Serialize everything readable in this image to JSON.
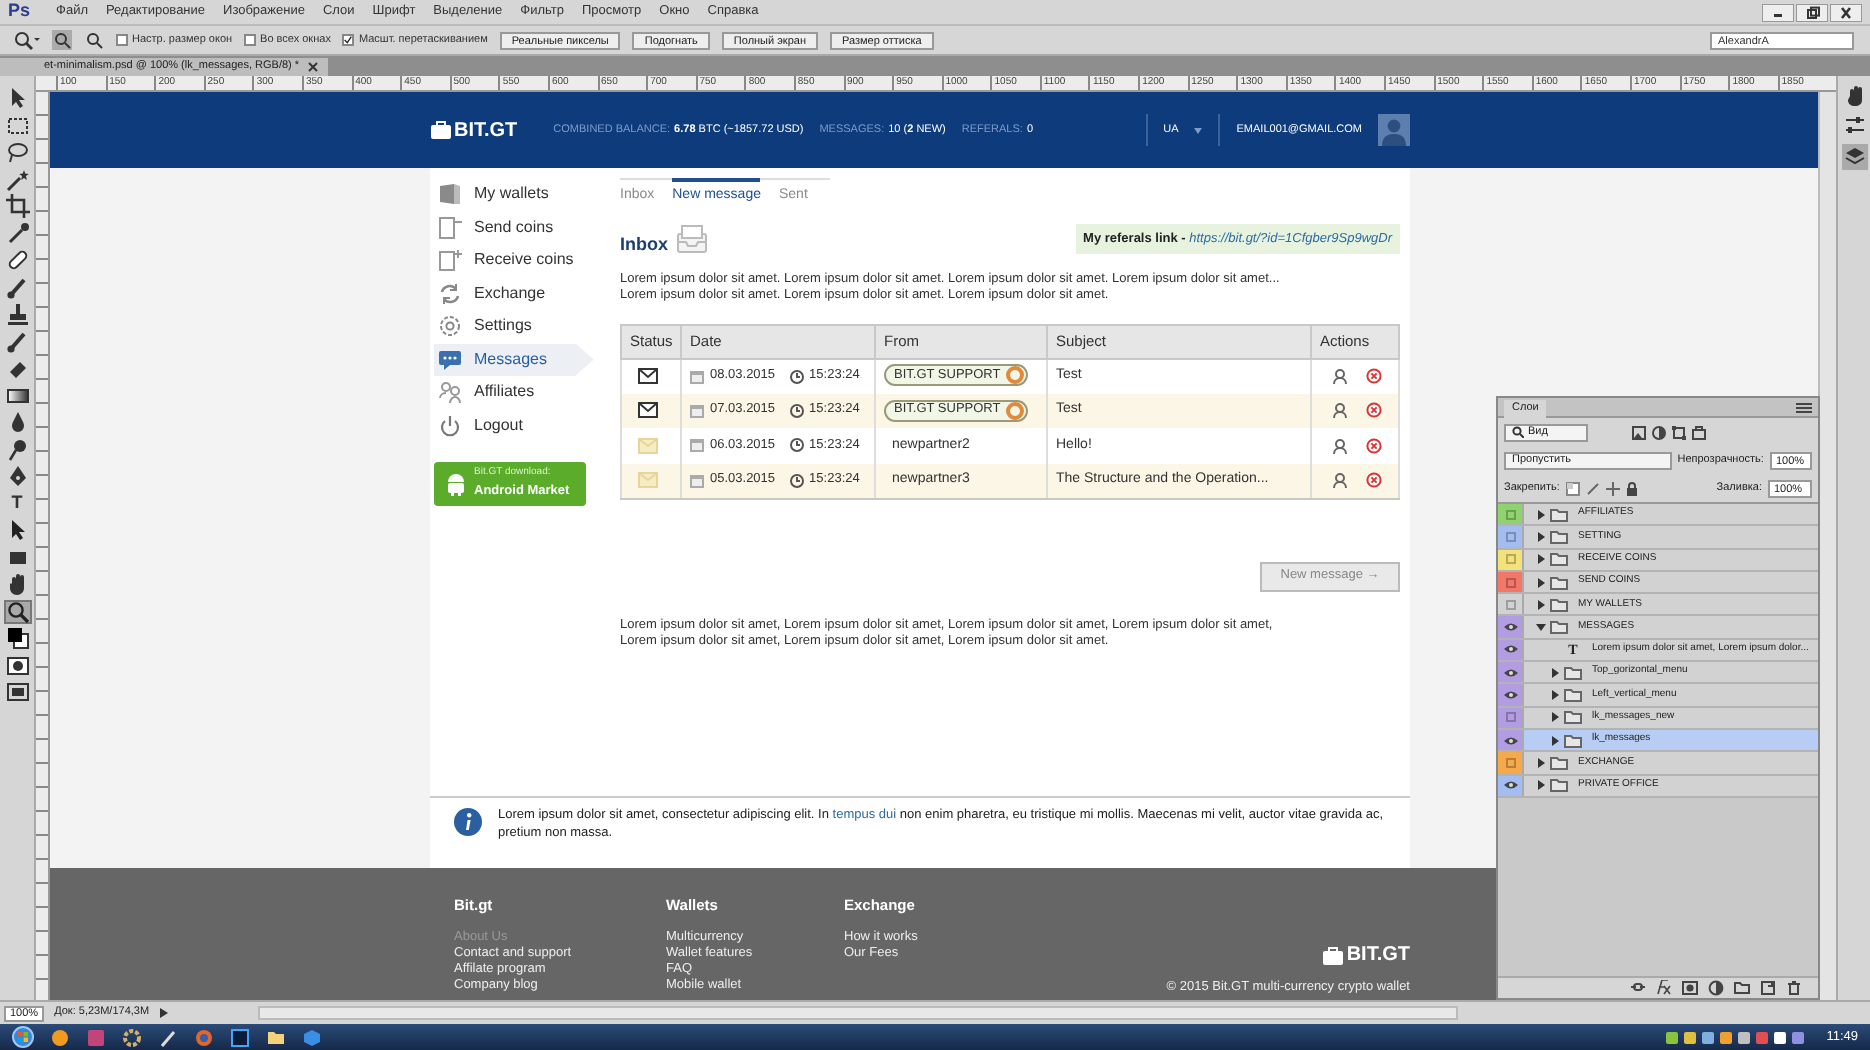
{
  "app": {
    "logo": "Ps",
    "menu": [
      "Файл",
      "Редактирование",
      "Изображение",
      "Слои",
      "Шрифт",
      "Выделение",
      "Фильтр",
      "Просмотр",
      "Окно",
      "Справка"
    ]
  },
  "options_bar": {
    "checkboxes": [
      {
        "label": "Настр. размер окон",
        "checked": false
      },
      {
        "label": "Во всех окнах",
        "checked": false
      },
      {
        "label": "Масшт. перетаскиванием",
        "checked": true
      }
    ],
    "buttons": [
      "Реальные пикселы",
      "Подогнать",
      "Полный экран",
      "Размер оттиска"
    ],
    "workspace": "AlexandrA"
  },
  "document_tab": {
    "title": "et-minimalism.psd @ 100% (lk_messages, RGB/8) *"
  },
  "tools": [
    {
      "kind": "move",
      "selected": false
    },
    {
      "kind": "marquee",
      "selected": false
    },
    {
      "kind": "lasso",
      "selected": false
    },
    {
      "kind": "wand",
      "selected": false
    },
    {
      "kind": "crop",
      "selected": false
    },
    {
      "kind": "eyedropper",
      "selected": false
    },
    {
      "kind": "bandage",
      "selected": false
    },
    {
      "kind": "brush",
      "selected": false
    },
    {
      "kind": "stamp",
      "selected": false
    },
    {
      "kind": "brush",
      "selected": false
    },
    {
      "kind": "eraser",
      "selected": false
    },
    {
      "kind": "gradient",
      "selected": false
    },
    {
      "kind": "drop",
      "selected": false
    },
    {
      "kind": "dodge",
      "selected": false
    },
    {
      "kind": "pen",
      "selected": false
    },
    {
      "kind": "type",
      "glyph": "T",
      "selected": false
    },
    {
      "kind": "pointer",
      "selected": false
    },
    {
      "kind": "shape",
      "selected": false
    },
    {
      "kind": "hand",
      "selected": false
    },
    {
      "kind": "zoom",
      "selected": true
    },
    {
      "kind": "swatches",
      "selected": false
    },
    {
      "kind": "mask",
      "selected": false
    },
    {
      "kind": "screen",
      "selected": false
    }
  ],
  "ruler_labels": [
    "100",
    "150",
    "200",
    "250",
    "300",
    "350",
    "400",
    "450",
    "500",
    "550",
    "600",
    "650",
    "700",
    "750",
    "800",
    "850",
    "900",
    "950",
    "1000",
    "1050",
    "1100",
    "1150",
    "1200",
    "1250",
    "1300",
    "1350",
    "1400",
    "1450",
    "1500",
    "1550",
    "1600",
    "1650",
    "1700",
    "1750",
    "1800",
    "1850"
  ],
  "site": {
    "header": {
      "logo": "BIT.GT",
      "balance_label": "COMBINED BALANCE:",
      "balance": "**6.78** BTC (~1857.72 USD)",
      "messages_label": "MESSAGES:",
      "messages": "10 (**2** NEW)",
      "referrals_label": "REFERALS:",
      "referrals": "0",
      "language": "UA",
      "email": "EMAIL001@GMAIL.COM"
    },
    "sidebar": {
      "items": [
        {
          "kind": "wallets",
          "label": "My wallets",
          "selected": false
        },
        {
          "kind": "send",
          "label": "Send coins",
          "selected": false
        },
        {
          "kind": "receive",
          "label": "Receive coins",
          "selected": false
        },
        {
          "kind": "exchange",
          "label": "Exchange",
          "selected": false
        },
        {
          "kind": "settings",
          "label": "Settings",
          "selected": false
        },
        {
          "kind": "messages",
          "label": "Messages",
          "selected": true
        },
        {
          "kind": "affiliates",
          "label": "Affiliates",
          "selected": false
        },
        {
          "kind": "logout",
          "label": "Logout",
          "selected": false
        }
      ],
      "android_button": {
        "line_1": "Bit.GT download:",
        "line_2": "Android Market"
      }
    },
    "tabs": [
      {
        "label": "Inbox",
        "selected": false
      },
      {
        "label": "New message",
        "selected": true
      },
      {
        "label": "Sent",
        "selected": false
      }
    ],
    "title": "Inbox",
    "referral": {
      "label": "My referals link - ",
      "link": "https://bit.gt/?id=1Cfgber9Sp9wgDr"
    },
    "intro": [
      "Lorem ipsum dolor sit amet. Lorem ipsum dolor sit amet. Lorem ipsum dolor sit amet. Lorem ipsum dolor sit amet...",
      "Lorem ipsum dolor sit amet. Lorem ipsum dolor sit amet. Lorem ipsum dolor sit amet."
    ],
    "table": {
      "columns": [
        "Status",
        "Date",
        "From",
        "Subject",
        "Actions"
      ],
      "rows": [
        {
          "kind": "support",
          "read": false,
          "date": "08.03.2015",
          "time": "15:23:24",
          "from": "BIT.GT SUPPORT",
          "subject": "Test"
        },
        {
          "kind": "support",
          "read": false,
          "date": "07.03.2015",
          "time": "15:23:24",
          "from": "BIT.GT SUPPORT",
          "subject": "Test"
        },
        {
          "kind": "user",
          "read": true,
          "date": "06.03.2015",
          "time": "15:23:24",
          "from": "newpartner2",
          "subject": "Hello!"
        },
        {
          "kind": "user",
          "read": true,
          "date": "05.03.2015",
          "time": "15:23:24",
          "from": "newpartner3",
          "subject": "The Structure and the Operation..."
        }
      ]
    },
    "new_message_button": {
      "label": "New message →",
      "disabled": true
    },
    "paragraph": [
      "Lorem ipsum dolor sit amet, Lorem ipsum dolor sit amet, Lorem ipsum dolor sit amet, Lorem ipsum dolor sit amet,",
      "Lorem ipsum dolor sit amet, Lorem ipsum dolor sit amet, Lorem ipsum dolor sit amet."
    ],
    "info": {
      "before": "Lorem ipsum dolor sit amet, consectetur adipiscing elit. In ",
      "link": "tempus dui",
      "after": " non enim pharetra, eu tristique mi mollis. Maecenas mi velit, auctor vitae gravida ac, pretium non massa."
    },
    "footer": {
      "columns": [
        {
          "title": "Bit.gt",
          "links": [
            {
              "label": "About Us",
              "dimmed": true
            },
            {
              "label": "Contact and support",
              "dimmed": false
            },
            {
              "label": "Affilate program",
              "dimmed": false
            },
            {
              "label": "Company blog",
              "dimmed": false
            }
          ]
        },
        {
          "title": "Wallets",
          "links": [
            {
              "label": "Multicurrency",
              "dimmed": false
            },
            {
              "label": "Wallet features",
              "dimmed": false
            },
            {
              "label": "FAQ",
              "dimmed": false
            },
            {
              "label": "Mobile wallet",
              "dimmed": false
            }
          ]
        },
        {
          "title": "Exchange",
          "links": [
            {
              "label": "How it works",
              "dimmed": false
            },
            {
              "label": "Our Fees",
              "dimmed": false
            }
          ]
        }
      ],
      "logo": "BIT.GT",
      "copyright": "© 2015 Bit.GT multi-currency crypto wallet"
    }
  },
  "layers_panel": {
    "title": "Слои",
    "filter": "Вид",
    "blend_mode": "Пропустить",
    "opacity_label": "Непрозрачность:",
    "opacity": "100%",
    "lock_label": "Закрепить:",
    "fill_label": "Заливка:",
    "fill": "100%",
    "layers": [
      {
        "kind": "group",
        "name": "AFFILIATES",
        "color": "#8fd36f",
        "visible": false,
        "expanded": false,
        "selected": false
      },
      {
        "kind": "group",
        "name": "SETTING",
        "color": "#a3bdf0",
        "visible": false,
        "expanded": false,
        "selected": false
      },
      {
        "kind": "group",
        "name": "RECEIVE COINS",
        "color": "#f3e27a",
        "visible": false,
        "expanded": false,
        "selected": false
      },
      {
        "kind": "group",
        "name": "SEND COINS",
        "color": "#f2776a",
        "visible": false,
        "expanded": false,
        "selected": false
      },
      {
        "kind": "group",
        "name": "MY WALLETS",
        "visible": false,
        "expanded": false,
        "selected": false
      },
      {
        "kind": "group",
        "name": "MESSAGES",
        "color": "#b39de2",
        "visible": true,
        "expanded": true,
        "selected": false,
        "children": [
          {
            "kind": "text",
            "glyph": "T",
            "name": "Lorem ipsum dolor sit amet, Lorem ipsum dolor...",
            "color": "#b39de2",
            "visible": true,
            "selected": false
          },
          {
            "kind": "group",
            "name": "Top_gorizontal_menu",
            "color": "#b39de2",
            "visible": true,
            "expanded": false,
            "selected": false
          },
          {
            "kind": "group",
            "name": "Left_vertical_menu",
            "color": "#b39de2",
            "visible": true,
            "expanded": false,
            "selected": false
          },
          {
            "kind": "group",
            "name": "lk_messages_new",
            "color": "#b39de2",
            "visible": false,
            "expanded": false,
            "selected": false
          },
          {
            "kind": "group",
            "name": "lk_messages",
            "color": "#b39de2",
            "visible": true,
            "expanded": false,
            "selected": true
          }
        ]
      },
      {
        "kind": "group",
        "name": "EXCHANGE",
        "color": "#f5a94a",
        "visible": false,
        "expanded": false,
        "selected": false
      },
      {
        "kind": "group",
        "name": "PRIVATE OFFICE",
        "color": "#a3bdf0",
        "visible": true,
        "expanded": false,
        "selected": false
      }
    ]
  },
  "status_bar": {
    "zoom": "100%",
    "document": "Док: 5,23M/174,3M"
  },
  "taskbar": {
    "time": "11:49"
  }
}
